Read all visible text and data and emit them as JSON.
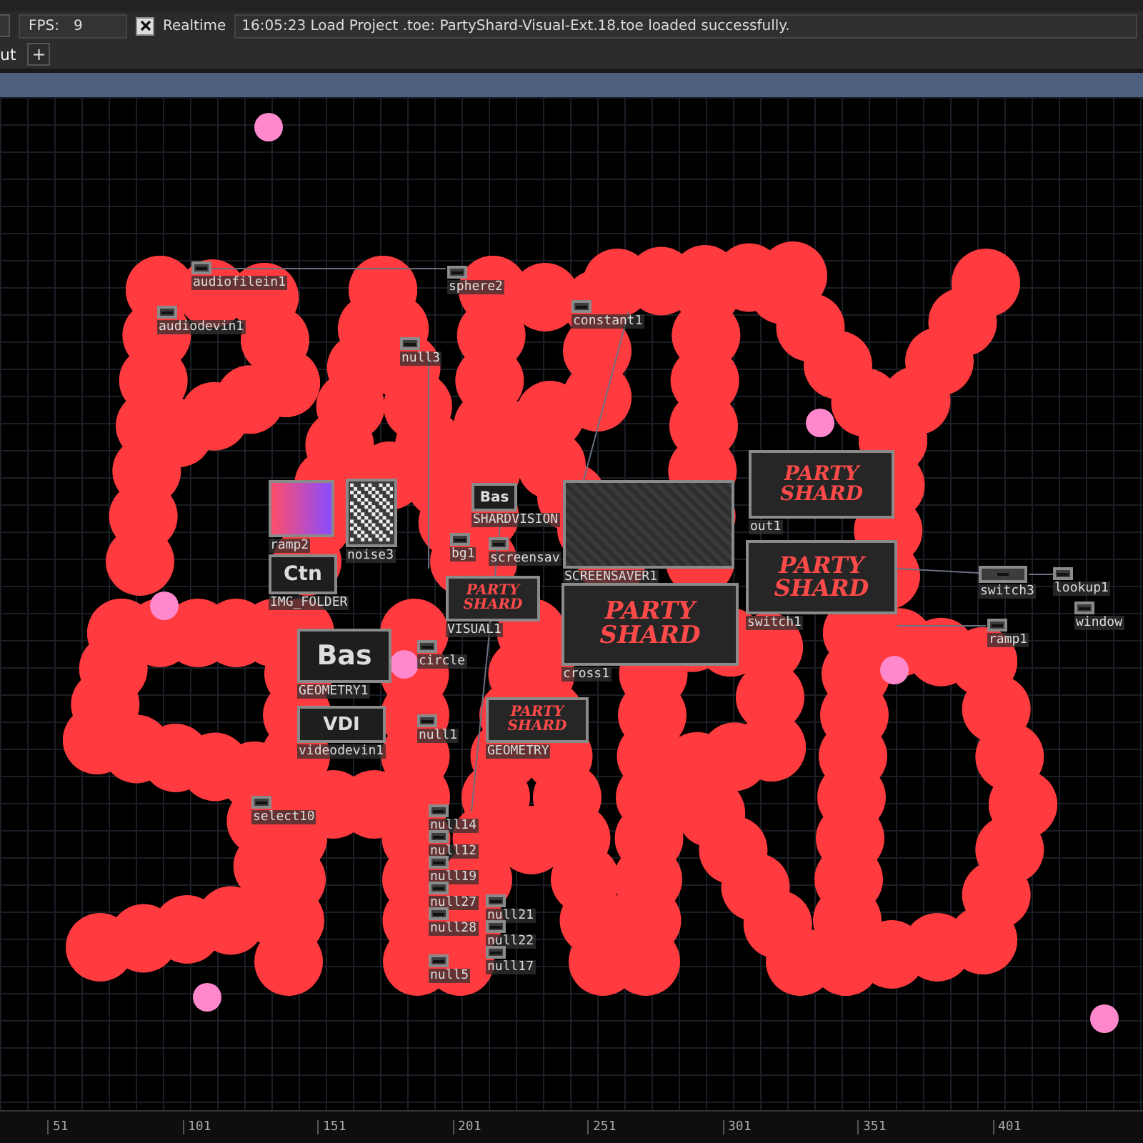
{
  "status_bar": {
    "fps_label": "FPS:",
    "fps_value": "9",
    "realtime": {
      "label": "Realtime",
      "checked": true
    },
    "message": "16:05:23 Load Project .toe: PartyShard-Visual-Ext.18.toe loaded successfully."
  },
  "tabs": [
    {
      "label": "ut",
      "selected": true
    }
  ],
  "add_tab": "+",
  "nodes": [
    {
      "label": "audiofilein1",
      "kind": "small"
    },
    {
      "label": "audiodevin1",
      "kind": "small"
    },
    {
      "label": "sphere2",
      "kind": "small"
    },
    {
      "label": "constant1",
      "kind": "small"
    },
    {
      "label": "null3",
      "kind": "small"
    },
    {
      "label": "ramp2",
      "kind": "gradient"
    },
    {
      "label": "noise3",
      "kind": "noise"
    },
    {
      "label": "IMG_FOLDER",
      "kind": "text",
      "text": "Ctn"
    },
    {
      "label": "GEOMETRY1",
      "kind": "text",
      "text": "Bas"
    },
    {
      "label": "videodevin1",
      "kind": "text",
      "text": "VDI"
    },
    {
      "label": "SHARDVISION",
      "kind": "text",
      "text": "Bas"
    },
    {
      "label": "bg1",
      "kind": "small"
    },
    {
      "label": "screensav",
      "kind": "small"
    },
    {
      "label": "circle",
      "kind": "small"
    },
    {
      "label": "null1",
      "kind": "small"
    },
    {
      "label": "VISUAL1",
      "kind": "party",
      "lines": [
        "PARTY",
        "SHARD"
      ]
    },
    {
      "label": "SCREENSAVER1",
      "kind": "screen"
    },
    {
      "label": "cross1",
      "kind": "party",
      "lines": [
        "PARTY",
        "SHARD"
      ]
    },
    {
      "label": "out1",
      "kind": "party",
      "lines": [
        "PARTY",
        "SHARD"
      ]
    },
    {
      "label": "switch1",
      "kind": "party",
      "lines": [
        "PARTY",
        "SHARD"
      ]
    },
    {
      "label": "GEOMETRY",
      "kind": "party",
      "lines": [
        "PARTY",
        "SHARD"
      ]
    },
    {
      "label": "switch3",
      "kind": "small"
    },
    {
      "label": "lookup1",
      "kind": "small"
    },
    {
      "label": "window",
      "kind": "small"
    },
    {
      "label": "ramp1",
      "kind": "small"
    },
    {
      "label": "select10",
      "kind": "small"
    },
    {
      "label": "null14",
      "kind": "small"
    },
    {
      "label": "null12",
      "kind": "small"
    },
    {
      "label": "null19",
      "kind": "small"
    },
    {
      "label": "null27",
      "kind": "small"
    },
    {
      "label": "null28",
      "kind": "small"
    },
    {
      "label": "null5",
      "kind": "small"
    },
    {
      "label": "null21",
      "kind": "small"
    },
    {
      "label": "null22",
      "kind": "small"
    },
    {
      "label": "null17",
      "kind": "small"
    }
  ],
  "ruler": [
    "51",
    "101",
    "151",
    "201",
    "251",
    "301",
    "351",
    "401"
  ]
}
